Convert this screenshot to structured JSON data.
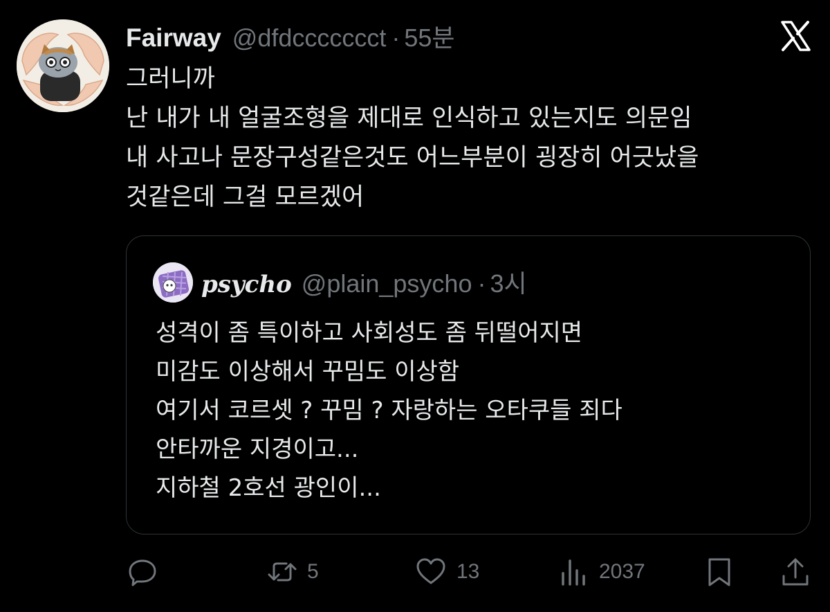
{
  "tweet": {
    "display_name": "Fairway",
    "handle": "@dfdccccccct",
    "separator": "·",
    "time": "55분",
    "lines": [
      "그러니까",
      "난 내가 내 얼굴조형을 제대로 인식하고 있는지도 의문임",
      "내 사고나 문장구성같은것도 어느부분이 굉장히 어긋났을",
      "것같은데 그걸 모르겠어"
    ]
  },
  "quoted": {
    "display_name": "psycho",
    "handle": "@plain_psycho",
    "separator": "·",
    "time": "3시",
    "lines": [
      "성격이 좀 특이하고 사회성도 좀 뒤떨어지면",
      "미감도 이상해서 꾸밈도 이상함",
      "여기서 코르셋 ? 꾸밈 ? 자랑하는 오타쿠들 죄다",
      "안타까운 지경이고...",
      "지하철 2호선 광인이..."
    ]
  },
  "actions": {
    "reply_icon": "reply-icon",
    "retweet_icon": "retweet-icon",
    "retweets": "5",
    "like_icon": "heart-icon",
    "likes": "13",
    "views_icon": "views-icon",
    "views": "2037",
    "bookmark_icon": "bookmark-icon",
    "share_icon": "share-icon"
  },
  "colors": {
    "background": "#000000",
    "text_primary": "#e7e9ea",
    "text_secondary": "#71767b",
    "border": "#2f3336"
  },
  "branding": {
    "logo_icon": "x-logo-icon"
  }
}
